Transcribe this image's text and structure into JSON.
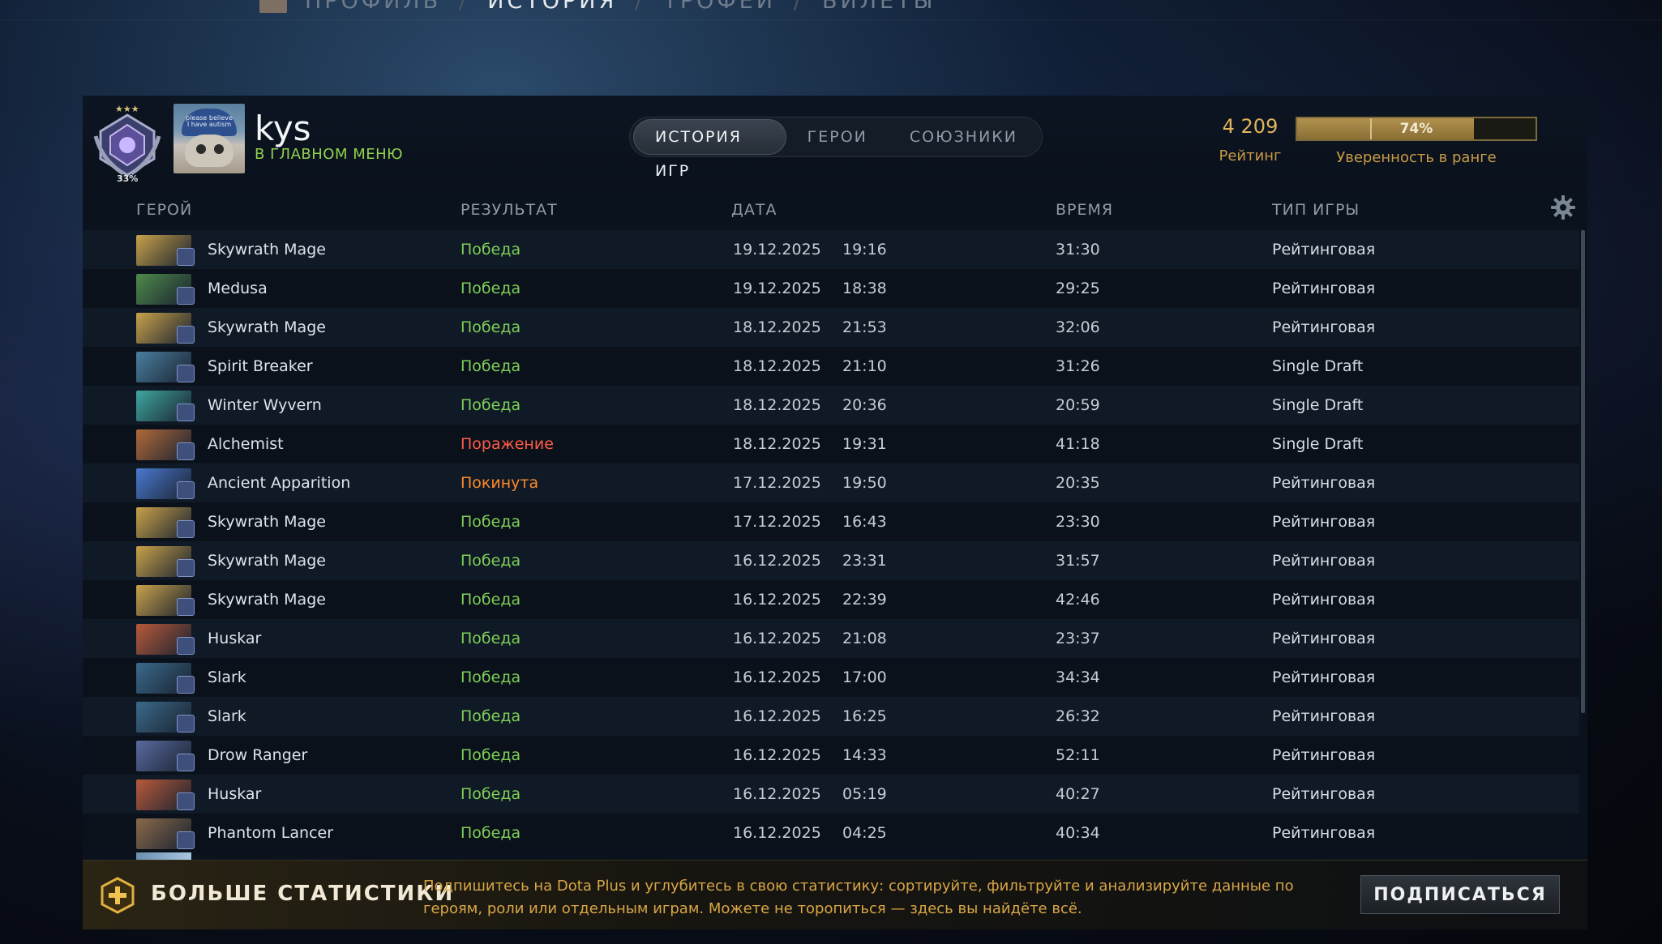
{
  "nav": {
    "items": [
      "ПРОФИЛЬ",
      "ИСТОРИЯ",
      "ТРОФЕИ",
      "БИЛЕТЫ"
    ],
    "active": "ИСТОРИЯ",
    "separator": "/"
  },
  "profile": {
    "name": "kys",
    "status": "В ГЛАВНОМ МЕНЮ",
    "medal_percent": "33%",
    "avatar_cap_text": "please believe I have autism"
  },
  "tabs": [
    "ИСТОРИЯ ИГР",
    "ГЕРОИ",
    "СОЮЗНИКИ"
  ],
  "rating": {
    "value": "4 209",
    "label": "Рейтинг"
  },
  "confidence": {
    "value": "74%",
    "fraction": 0.74,
    "label": "Уверенность в ранге"
  },
  "columns": {
    "hero": "ГЕРОЙ",
    "result": "РЕЗУЛЬТАТ",
    "date": "ДАТА",
    "duration": "ВРЕМЯ",
    "type": "ТИП ИГРЫ"
  },
  "matches": [
    {
      "hero": "Skywrath Mage",
      "result": "Победа",
      "status": "win",
      "date": "19.12.2025",
      "time": "19:16",
      "duration": "31:30",
      "type": "Рейтинговая",
      "color": "#c9a24a"
    },
    {
      "hero": "Medusa",
      "result": "Победа",
      "status": "win",
      "date": "19.12.2025",
      "time": "18:38",
      "duration": "29:25",
      "type": "Рейтинговая",
      "color": "#4e8a4a"
    },
    {
      "hero": "Skywrath Mage",
      "result": "Победа",
      "status": "win",
      "date": "18.12.2025",
      "time": "21:53",
      "duration": "32:06",
      "type": "Рейтинговая",
      "color": "#c9a24a"
    },
    {
      "hero": "Spirit Breaker",
      "result": "Победа",
      "status": "win",
      "date": "18.12.2025",
      "time": "21:10",
      "duration": "31:26",
      "type": "Single Draft",
      "color": "#4a7fa0"
    },
    {
      "hero": "Winter Wyvern",
      "result": "Победа",
      "status": "win",
      "date": "18.12.2025",
      "time": "20:36",
      "duration": "20:59",
      "type": "Single Draft",
      "color": "#3fa6a0"
    },
    {
      "hero": "Alchemist",
      "result": "Поражение",
      "status": "loss",
      "date": "18.12.2025",
      "time": "19:31",
      "duration": "41:18",
      "type": "Single Draft",
      "color": "#b06a3a"
    },
    {
      "hero": "Ancient Apparition",
      "result": "Покинута",
      "status": "abandon",
      "date": "17.12.2025",
      "time": "19:50",
      "duration": "20:35",
      "type": "Рейтинговая",
      "color": "#4a7ad0"
    },
    {
      "hero": "Skywrath Mage",
      "result": "Победа",
      "status": "win",
      "date": "17.12.2025",
      "time": "16:43",
      "duration": "23:30",
      "type": "Рейтинговая",
      "color": "#c9a24a"
    },
    {
      "hero": "Skywrath Mage",
      "result": "Победа",
      "status": "win",
      "date": "16.12.2025",
      "time": "23:31",
      "duration": "31:57",
      "type": "Рейтинговая",
      "color": "#c9a24a"
    },
    {
      "hero": "Skywrath Mage",
      "result": "Победа",
      "status": "win",
      "date": "16.12.2025",
      "time": "22:39",
      "duration": "42:46",
      "type": "Рейтинговая",
      "color": "#c9a24a"
    },
    {
      "hero": "Huskar",
      "result": "Победа",
      "status": "win",
      "date": "16.12.2025",
      "time": "21:08",
      "duration": "23:37",
      "type": "Рейтинговая",
      "color": "#b85a3a"
    },
    {
      "hero": "Slark",
      "result": "Победа",
      "status": "win",
      "date": "16.12.2025",
      "time": "17:00",
      "duration": "34:34",
      "type": "Рейтинговая",
      "color": "#3a6a8a"
    },
    {
      "hero": "Slark",
      "result": "Победа",
      "status": "win",
      "date": "16.12.2025",
      "time": "16:25",
      "duration": "26:32",
      "type": "Рейтинговая",
      "color": "#3a6a8a"
    },
    {
      "hero": "Drow Ranger",
      "result": "Победа",
      "status": "win",
      "date": "16.12.2025",
      "time": "14:33",
      "duration": "52:11",
      "type": "Рейтинговая",
      "color": "#5a6aa0"
    },
    {
      "hero": "Huskar",
      "result": "Победа",
      "status": "win",
      "date": "16.12.2025",
      "time": "05:19",
      "duration": "40:27",
      "type": "Рейтинговая",
      "color": "#b85a3a"
    },
    {
      "hero": "Phantom Lancer",
      "result": "Победа",
      "status": "win",
      "date": "16.12.2025",
      "time": "04:25",
      "duration": "40:34",
      "type": "Рейтинговая",
      "color": "#8a6a4a"
    }
  ],
  "banner": {
    "title": "БОЛЬШЕ СТАТИСТИКИ",
    "text": "Подпишитесь на Dota Plus и углубитесь в свою статистику: сортируйте, фильтруйте и анализируйте данные по героям, роли или отдельным играм. Можете не торопиться — здесь вы найдёте всё.",
    "button": "ПОДПИСАТЬСЯ"
  }
}
